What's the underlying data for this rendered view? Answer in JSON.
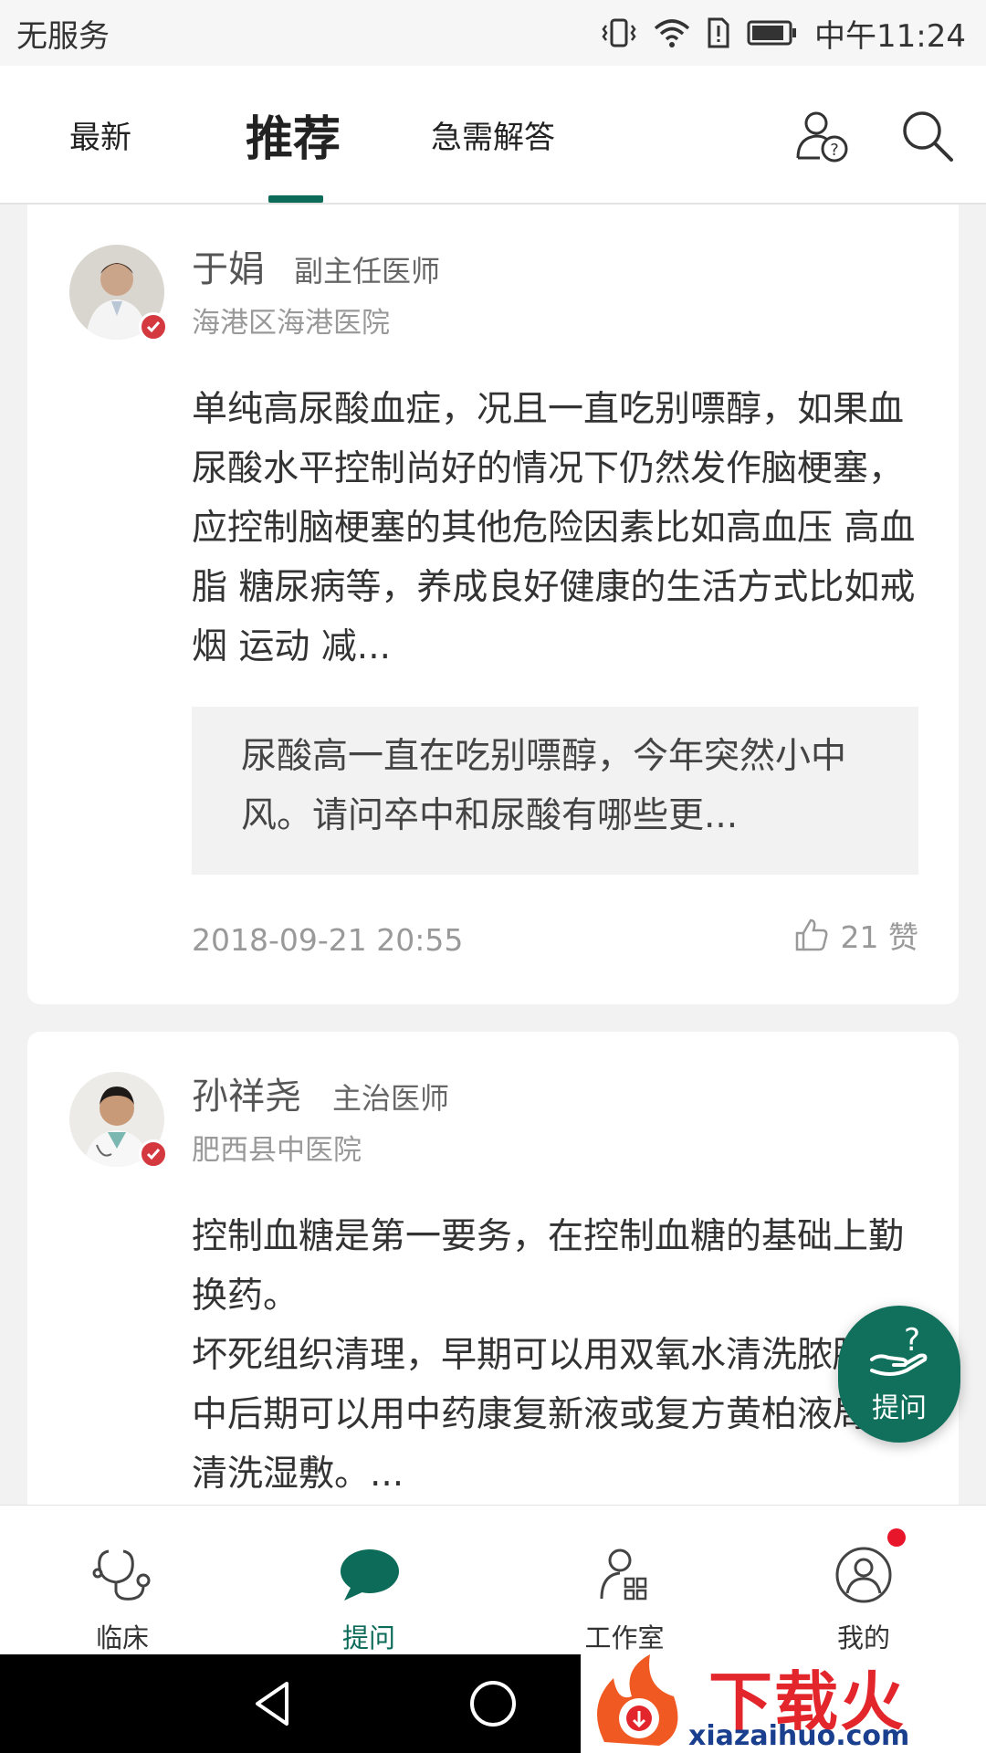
{
  "status_bar": {
    "carrier": "无服务",
    "time": "中午11:24"
  },
  "top_nav": {
    "tabs": [
      {
        "label": "最新",
        "active": false
      },
      {
        "label": "推荐",
        "active": true
      },
      {
        "label": "急需解答",
        "active": false
      }
    ],
    "icons": [
      "ask-doctor-icon",
      "search-icon"
    ]
  },
  "feed": [
    {
      "doctor_name": "于娟",
      "doctor_title": "副主任医师",
      "hospital": "海港区海港医院",
      "answer": "单纯高尿酸血症，况且一直吃别嘌醇，如果血尿酸水平控制尚好的情况下仍然发作脑梗塞，应控制脑梗塞的其他危险因素比如高血压 高血脂 糖尿病等，养成良好健康的生活方式比如戒烟 运动 减...",
      "question": "尿酸高一直在吃别嘌醇，今年突然小中风。请问卒中和尿酸有哪些更...",
      "timestamp": "2018-09-21 20:55",
      "likes": "21 赞"
    },
    {
      "doctor_name": "孙祥尧",
      "doctor_title": "主治医师",
      "hospital": "肥西县中医院",
      "answer_lines": [
        "控制血糖是第一要务，在控制血糖的基础上勤换药。",
        "坏死组织清理，早期可以用双氧水清洗脓腔。中后期可以用中药康复新液或复方黄柏液局部清洗湿敷。..."
      ]
    }
  ],
  "fab": {
    "label": "提问",
    "icon": "hand-question-icon"
  },
  "bottom_tabs": [
    {
      "label": "临床",
      "icon": "stethoscope-icon",
      "active": false
    },
    {
      "label": "提问",
      "icon": "chat-bubble-icon",
      "active": true
    },
    {
      "label": "工作室",
      "icon": "studio-icon",
      "active": false
    },
    {
      "label": "我的",
      "icon": "profile-icon",
      "active": false
    }
  ],
  "watermark": {
    "brand": "下载火",
    "url": "xiazaihuo.com"
  },
  "colors": {
    "accent": "#0c6b59",
    "badge": "#d4393f",
    "notification": "#e8162a"
  }
}
